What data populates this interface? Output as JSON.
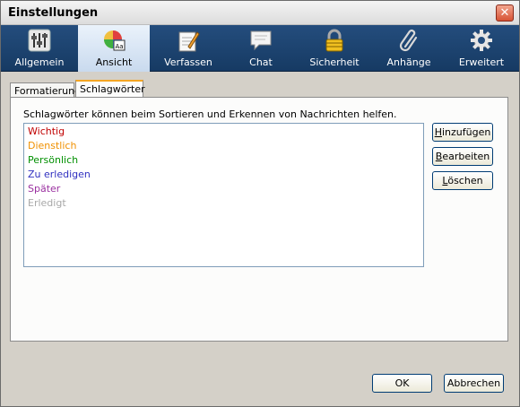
{
  "window": {
    "title": "Einstellungen",
    "close_glyph": "✕"
  },
  "toolbar": {
    "items": [
      {
        "label": "Allgemein",
        "icon": "sliders-icon"
      },
      {
        "label": "Ansicht",
        "icon": "color-wheel-icon",
        "badge": "Aa"
      },
      {
        "label": "Verfassen",
        "icon": "notepad-pen-icon"
      },
      {
        "label": "Chat",
        "icon": "speech-bubble-icon"
      },
      {
        "label": "Sicherheit",
        "icon": "padlock-icon"
      },
      {
        "label": "Anhänge",
        "icon": "paperclip-icon"
      },
      {
        "label": "Erweitert",
        "icon": "gear-icon"
      }
    ],
    "active_index": 1
  },
  "tabs": [
    {
      "label": "Formatierung",
      "active": false
    },
    {
      "label": "Schlagwörter",
      "active": true
    }
  ],
  "tags_panel": {
    "description": "Schlagwörter können beim Sortieren und Erkennen von Nachrichten helfen.",
    "tags": [
      {
        "name": "Wichtig",
        "color": "#c00000"
      },
      {
        "name": "Dienstlich",
        "color": "#f09000"
      },
      {
        "name": "Persönlich",
        "color": "#009000"
      },
      {
        "name": "Zu erledigen",
        "color": "#3030c0"
      },
      {
        "name": "Später",
        "color": "#9a30a0"
      },
      {
        "name": "Erledigt",
        "color": "#a8a8a8"
      }
    ],
    "buttons": {
      "add": {
        "accel": "H",
        "rest": "inzufügen"
      },
      "edit": {
        "accel": "B",
        "rest": "earbeiten"
      },
      "delete": {
        "accel": "L",
        "rest": "öschen"
      }
    }
  },
  "footer": {
    "ok_label": "OK",
    "cancel_label": "Abbrechen"
  }
}
